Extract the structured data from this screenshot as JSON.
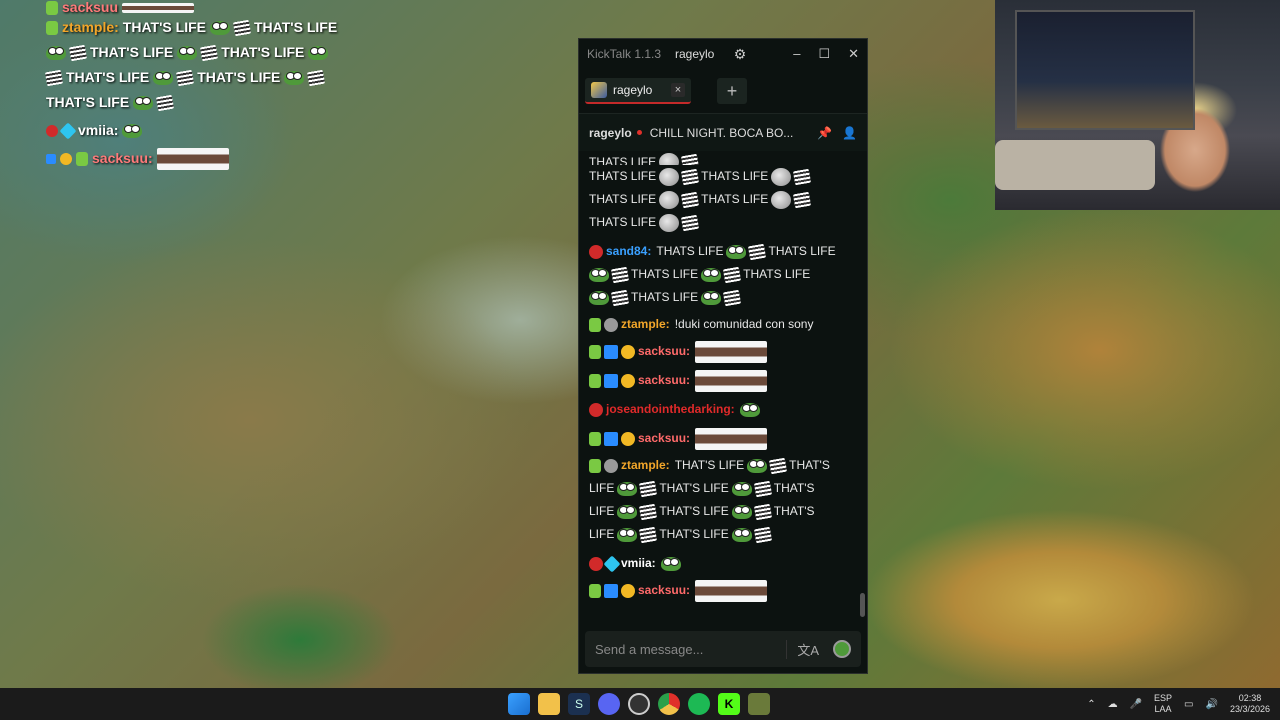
{
  "overlay": {
    "lines": [
      {
        "user": "sacksuu"
      },
      {
        "user": "ztample:",
        "user_color": "#f2a62a",
        "text": "THAT'S LIFE"
      },
      {
        "text": "THAT'S LIFE"
      },
      {
        "text": "THAT'S LIFE"
      },
      {
        "text": "THAT'S LIFE"
      },
      {
        "user": "vmiia:",
        "user_color": "#ffffff"
      },
      {
        "user": "sacksuu:",
        "user_color": "#ff7a7a"
      }
    ],
    "repeat_text": "THAT'S LIFE"
  },
  "kicktalk": {
    "app_name": "KickTalk 1.1.3",
    "username": "rageylo",
    "tab_label": "rageylo",
    "tab_close": "×",
    "add_tab": "+",
    "streamer": "rageylo",
    "stream_title": "CHILL NIGHT. BOCA BO...",
    "input_placeholder": "Send a message...",
    "translate_icon": "文A",
    "messages": [
      {
        "kind": "continuation",
        "parts": [
          "THATS LIFE",
          "THATS LIFE"
        ]
      },
      {
        "kind": "continuation",
        "parts": [
          "THATS LIFE",
          "THATS LIFE"
        ]
      },
      {
        "kind": "continuation",
        "parts": [
          "THATS LIFE"
        ]
      },
      {
        "kind": "user",
        "user": "sand84:",
        "color": "#3aa0ff",
        "text": "THATS LIFE",
        "text2": "THATS LIFE"
      },
      {
        "kind": "user",
        "user": "ztample:",
        "color": "#f2a62a",
        "text": "!duki comunidad con sony"
      },
      {
        "kind": "user",
        "user": "sacksuu:",
        "color": "#ff6a6a"
      },
      {
        "kind": "user",
        "user": "sacksuu:",
        "color": "#ff6a6a"
      },
      {
        "kind": "user",
        "user": "joseandointhedarking:",
        "color": "#e02a2a"
      },
      {
        "kind": "user",
        "user": "sacksuu:",
        "color": "#ff6a6a"
      },
      {
        "kind": "user",
        "user": "ztample:",
        "color": "#f2a62a",
        "text": "THAT'S LIFE",
        "text2": "THAT'S"
      },
      {
        "kind": "user",
        "user": "vmiia:",
        "color": "#ffffff"
      },
      {
        "kind": "user",
        "user": "sacksuu:",
        "color": "#ff6a6a"
      }
    ],
    "thatslife_rows": [
      [
        "LIFE",
        "THAT'S LIFE",
        "THAT'S"
      ],
      [
        "LIFE",
        "THAT'S LIFE",
        "THAT'S"
      ],
      [
        "LIFE",
        "THAT'S LIFE"
      ]
    ],
    "sand_rows": [
      [
        "THATS LIFE",
        "THATS LIFE"
      ],
      [
        "THATS LIFE"
      ]
    ]
  },
  "taskbar": {
    "lang_top": "ESP",
    "lang_bottom": "LAA",
    "time": "02:38",
    "date": "23/3/2026"
  }
}
